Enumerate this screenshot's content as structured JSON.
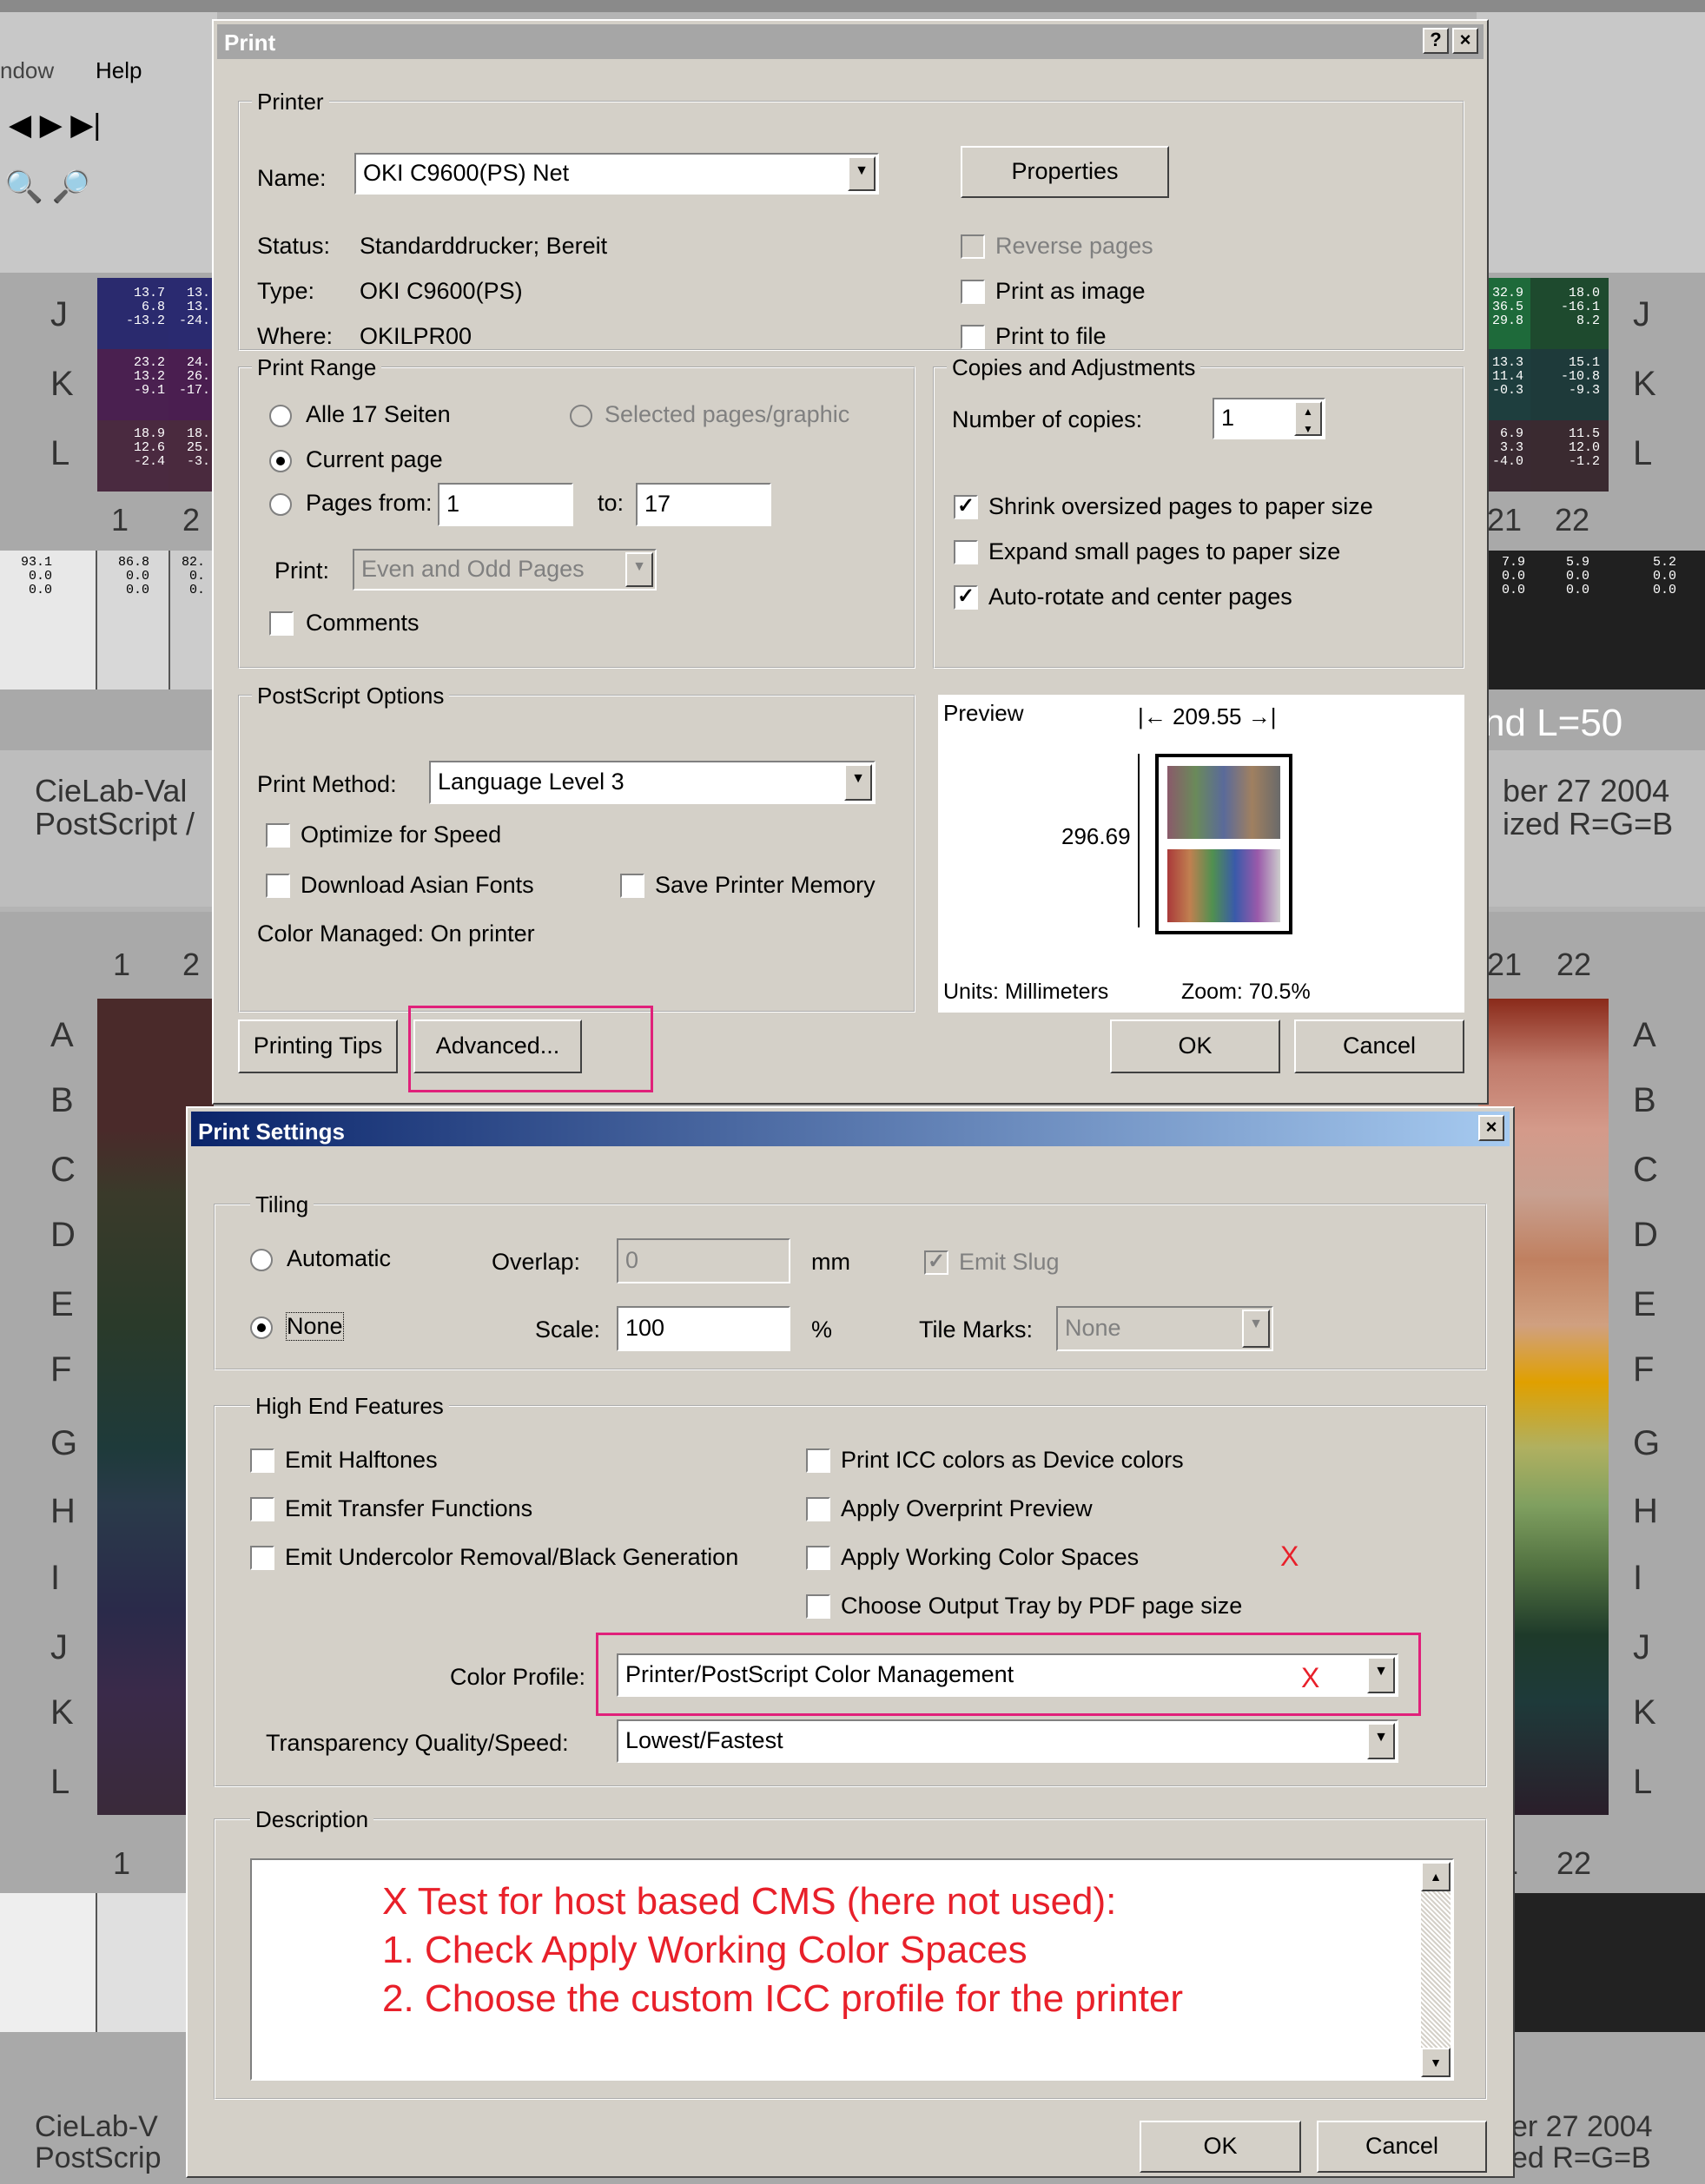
{
  "background": {
    "menu": {
      "window": "ndow",
      "help": "Help"
    },
    "top_chart": {
      "rows": [
        "J",
        "K",
        "L"
      ],
      "cols_left": [
        "1",
        "2"
      ],
      "cols_right": [
        "21",
        "22"
      ],
      "left_cells": [
        [
          "13.7",
          "6.8",
          "-13.2"
        ],
        [
          "13.",
          "13.",
          "-24."
        ],
        [
          "23.2",
          "13.2",
          "-9.1"
        ],
        [
          "24.",
          "26.",
          "-17."
        ],
        [
          "18.9",
          "12.6",
          "-2.4"
        ],
        [
          "18.",
          "25.",
          "-3."
        ]
      ],
      "right_cells": [
        [
          "32.9",
          "36.5",
          "29.8"
        ],
        [
          "18.0",
          "-16.1",
          "8.2"
        ],
        [
          "13.3",
          "11.4",
          "-0.3"
        ],
        [
          "15.1",
          "-10.8",
          "-9.3"
        ],
        [
          "6.9",
          "3.3",
          "-4.0"
        ],
        [
          "11.5",
          "12.0",
          "-1.2"
        ]
      ],
      "bottom_left": [
        [
          "93.1",
          "0.0",
          "0.0"
        ],
        [
          "86.8",
          "0.0",
          "0.0"
        ],
        [
          "82.",
          "0.",
          "0."
        ]
      ],
      "bottom_right": [
        [
          "7.9",
          "0.0",
          "0.0"
        ],
        [
          "5.9",
          "0.0",
          "0.0"
        ],
        [
          "5.2",
          "0.0",
          "0.0"
        ]
      ],
      "heading_right": "nd L=50",
      "caption_left_1": "CieLab-Val",
      "caption_left_2": "PostScript /",
      "caption_right_1": "ber 27 2004",
      "caption_right_2": "ized R=G=B"
    },
    "bottom_chart": {
      "rows": [
        "A",
        "B",
        "C",
        "D",
        "E",
        "F",
        "G",
        "H",
        "I",
        "J",
        "K",
        "L"
      ],
      "col_left_1": "1",
      "col_left_2": "2",
      "col_right_1": "21",
      "col_right_2": "22",
      "foot_left": "1",
      "foot_right_1": "1",
      "foot_right_2": "22",
      "caption_left_1": "CieLab-V",
      "caption_left_2": "PostScrip",
      "caption_right_1": "er 27 2004",
      "caption_right_2": "ed R=G=B"
    }
  },
  "print_dialog": {
    "title": "Print",
    "help_btn": "?",
    "close_btn": "×",
    "printer_group": "Printer",
    "name_label": "Name:",
    "name_value": "OKI C9600(PS) Net",
    "properties_btn": "Properties",
    "status_label": "Status:",
    "status_value": "Standarddrucker; Bereit",
    "type_label": "Type:",
    "type_value": "OKI C9600(PS)",
    "where_label": "Where:",
    "where_value": "OKILPR00",
    "reverse_pages": "Reverse pages",
    "print_as_image": "Print as image",
    "print_to_file": "Print to file",
    "range_group": "Print Range",
    "all_pages": "Alle 17 Seiten",
    "selected_pages": "Selected pages/graphic",
    "current_page": "Current page",
    "pages_from": "Pages from:",
    "from_value": "1",
    "to_label": "to:",
    "to_value": "17",
    "print_label": "Print:",
    "print_value": "Even and Odd Pages",
    "comments": "Comments",
    "copies_group": "Copies and Adjustments",
    "copies_label": "Number of copies:",
    "copies_value": "1",
    "shrink": "Shrink oversized pages to paper size",
    "expand": "Expand small pages to paper size",
    "autorotate": "Auto-rotate and center pages",
    "ps_group": "PostScript Options",
    "method_label": "Print Method:",
    "method_value": "Language Level 3",
    "optimize": "Optimize for Speed",
    "download_fonts": "Download Asian Fonts",
    "save_memory": "Save Printer Memory",
    "color_managed": "Color Managed:  On printer",
    "preview_label": "Preview",
    "preview_width": "209.55",
    "preview_height": "296.69",
    "units": "Units: Millimeters",
    "zoom": "Zoom: 70.5%",
    "tips_btn": "Printing Tips",
    "advanced_btn": "Advanced...",
    "ok_btn": "OK",
    "cancel_btn": "Cancel"
  },
  "settings_dialog": {
    "title": "Print Settings",
    "close_btn": "×",
    "tiling_group": "Tiling",
    "automatic": "Automatic",
    "none": "None",
    "overlap_label": "Overlap:",
    "overlap_value": "0",
    "overlap_unit": "mm",
    "emit_slug": "Emit Slug",
    "scale_label": "Scale:",
    "scale_value": "100",
    "scale_unit": "%",
    "tile_marks_label": "Tile Marks:",
    "tile_marks_value": "None",
    "hef_group": "High End Features",
    "emit_halftones": "Emit Halftones",
    "emit_transfer": "Emit Transfer Functions",
    "emit_ucr": "Emit Undercolor Removal/Black Generation",
    "print_icc": "Print ICC colors as Device colors",
    "apply_overprint": "Apply Overprint Preview",
    "apply_working": "Apply Working Color Spaces",
    "choose_tray": "Choose Output Tray by PDF page size",
    "color_profile_label": "Color Profile:",
    "color_profile_value": "Printer/PostScript Color Management",
    "transparency_label": "Transparency Quality/Speed:",
    "transparency_value": "Lowest/Fastest",
    "description_group": "Description",
    "description_lines": [
      "X  Test for host based CMS (here not used):",
      "1. Check  Apply Working Color Spaces",
      "2. Choose the custom ICC profile for the printer"
    ],
    "ok_btn": "OK",
    "cancel_btn": "Cancel"
  },
  "annotations": {
    "x_mark": "X",
    "highlight_color": "#e0207a",
    "text_color": "#e8202a"
  }
}
